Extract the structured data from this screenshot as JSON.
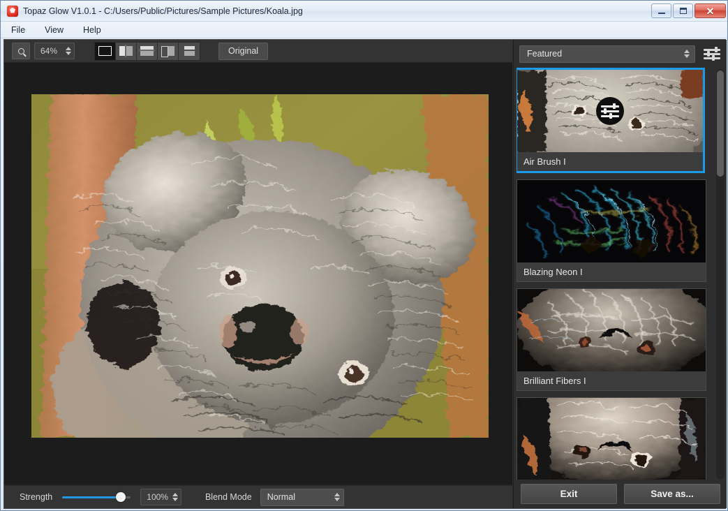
{
  "window": {
    "title": "Topaz Glow V1.0.1 - C:/Users/Public/Pictures/Sample Pictures/Koala.jpg",
    "app_icon": "topaz-glow-logo-icon",
    "minimize_label": "–",
    "maximize_label": "□",
    "close_label": "✕"
  },
  "menubar": {
    "items": [
      {
        "label": "File"
      },
      {
        "label": "View"
      },
      {
        "label": "Help"
      }
    ]
  },
  "toolbar": {
    "zoom_icon": "magnifier-icon",
    "zoom_value": "64%",
    "view_modes": [
      {
        "name": "single-view",
        "selected": true
      },
      {
        "name": "split-vertical-view",
        "selected": false
      },
      {
        "name": "split-horizontal-view",
        "selected": false
      },
      {
        "name": "side-by-side-view",
        "selected": false
      },
      {
        "name": "stacked-view",
        "selected": false
      }
    ],
    "original_label": "Original"
  },
  "canvas": {
    "image_name": "koala-stylized-preview",
    "background_color": "#1c1c1c"
  },
  "bottombar": {
    "strength_label": "Strength",
    "strength_value": "100%",
    "strength_percent": 86,
    "blend_mode_label": "Blend Mode",
    "blend_mode_value": "Normal"
  },
  "right_panel": {
    "category_value": "Featured",
    "settings_icon": "sliders-icon",
    "presets": [
      {
        "label": "Air Brush I",
        "selected": true,
        "has_gear": true,
        "thumb": "air-brush-thumb"
      },
      {
        "label": "Blazing Neon I",
        "selected": false,
        "has_gear": false,
        "thumb": "blazing-neon-thumb"
      },
      {
        "label": "Brilliant Fibers I",
        "selected": false,
        "has_gear": false,
        "thumb": "brilliant-fibers-thumb"
      },
      {
        "label": "",
        "selected": false,
        "has_gear": false,
        "thumb": "fourth-preset-thumb"
      }
    ],
    "exit_label": "Exit",
    "save_as_label": "Save as..."
  },
  "colors": {
    "accent_blue": "#1c9ae8",
    "slider_blue": "#2596e0",
    "panel_bg": "#2e2e2e",
    "toolbar_bg": "#333333",
    "canvas_bg": "#1c1c1c"
  }
}
